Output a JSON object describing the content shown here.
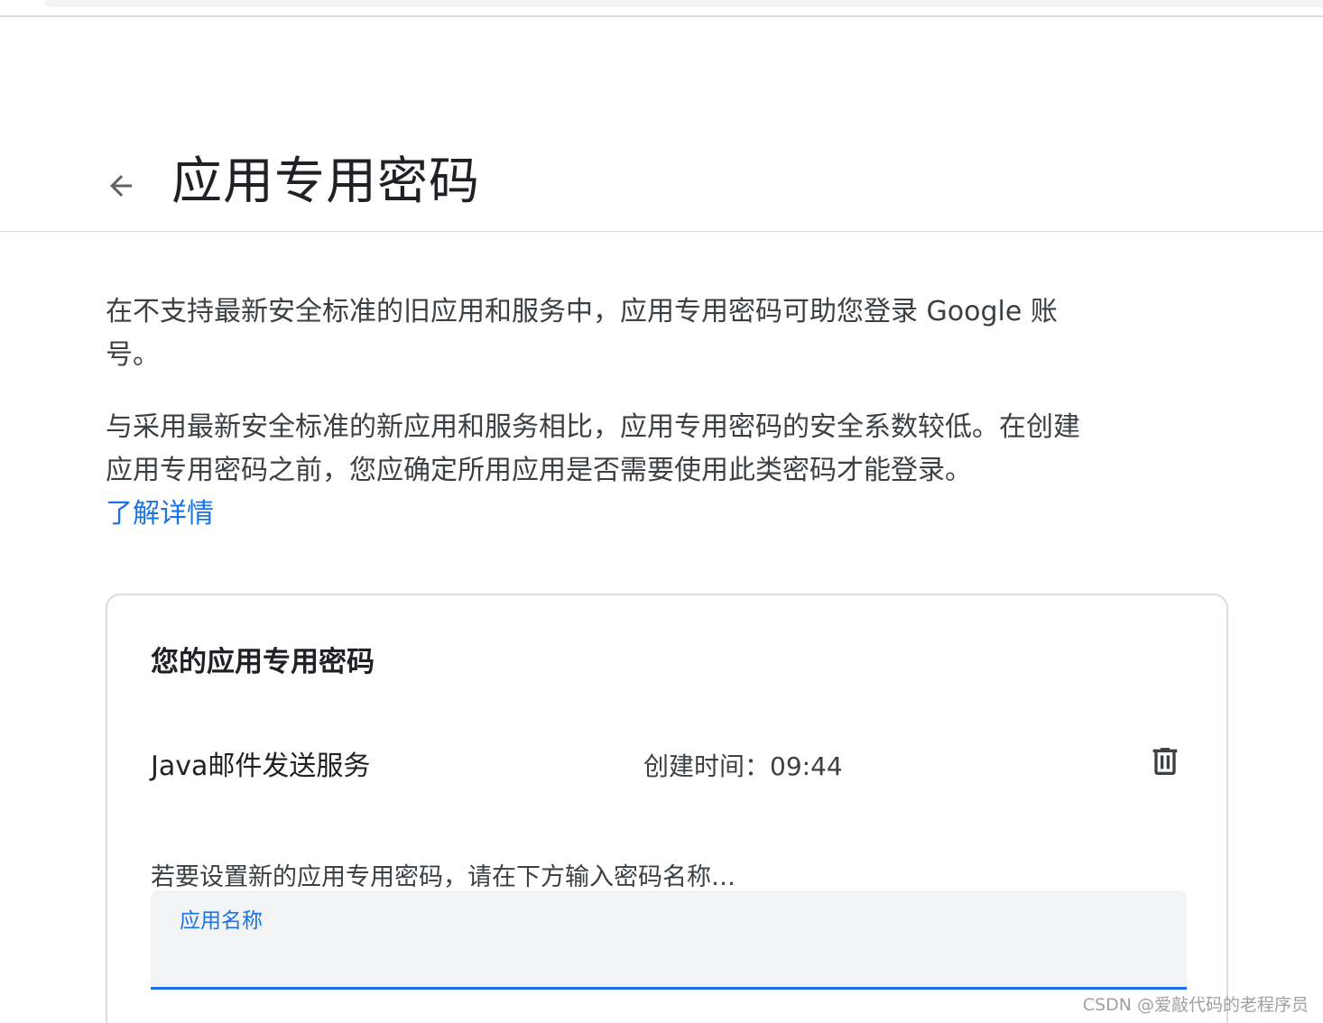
{
  "header": {
    "back_icon": "arrow-back-icon",
    "title": "应用专用密码"
  },
  "intro": {
    "paragraph1": "在不支持最新安全标准的旧应用和服务中，应用专用密码可助您登录 Google 账号。",
    "paragraph2": "与采用最新安全标准的新应用和服务相比，应用专用密码的安全系数较低。在创建应用专用密码之前，您应确定所用应用是否需要使用此类密码才能登录。",
    "learn_more": "了解详情"
  },
  "card": {
    "title": "您的应用专用密码",
    "passwords": [
      {
        "name": "Java邮件发送服务",
        "created": "创建时间：09:44",
        "delete_icon": "trash-icon"
      }
    ],
    "new_hint": "若要设置新的应用专用密码，请在下方输入密码名称…",
    "field": {
      "label": "应用名称",
      "value": ""
    }
  },
  "watermark": "CSDN @爱敲代码的老程序员",
  "colors": {
    "accent": "#1a73e8",
    "text": "#202124",
    "secondary_text": "#3c4043",
    "border": "#dadce0",
    "field_bg": "#f1f3f4"
  }
}
